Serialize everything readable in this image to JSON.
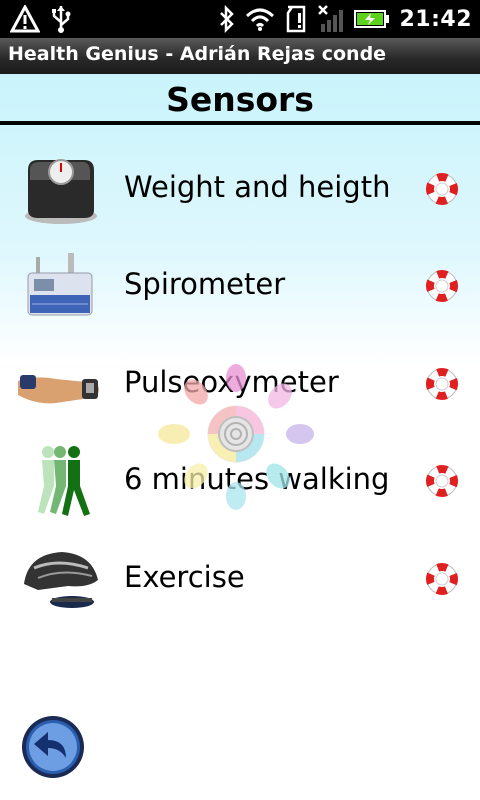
{
  "status_bar": {
    "time": "21:42",
    "icons": [
      "warning-icon",
      "usb-icon",
      "bluetooth-icon",
      "wifi-icon",
      "sd-card-icon",
      "no-signal-icon",
      "battery-charging-icon"
    ]
  },
  "app_bar": {
    "title": "Health Genius - Adrián Rejas conde"
  },
  "screen": {
    "title": "Sensors"
  },
  "sensors": [
    {
      "label": "Weight and heigth",
      "icon": "scale-icon"
    },
    {
      "label": "Spirometer",
      "icon": "spirometer-icon"
    },
    {
      "label": "Pulseoxymeter",
      "icon": "pulse-oximeter-icon"
    },
    {
      "label": "6 minutes walking",
      "icon": "walking-person-icon"
    },
    {
      "label": "Exercise",
      "icon": "cycling-helmet-icon"
    }
  ],
  "help_icon": "lifebuoy-help-icon",
  "footer": {
    "back_icon": "back-arrow-icon"
  },
  "overlay": {
    "loading_icon": "loading-spinner-icon"
  },
  "colors": {
    "header_tint": "#c9f3fb",
    "help_red": "#e02020",
    "back_blue": "#2a5fb0"
  }
}
